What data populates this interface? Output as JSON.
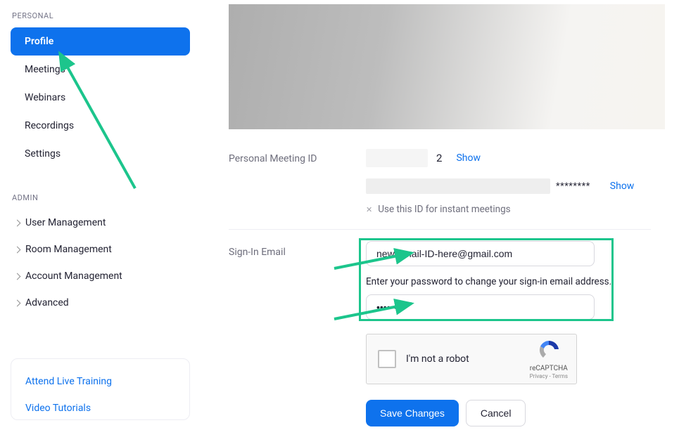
{
  "sidebar": {
    "personal_label": "PERSONAL",
    "items": [
      {
        "label": "Profile"
      },
      {
        "label": "Meetings"
      },
      {
        "label": "Webinars"
      },
      {
        "label": "Recordings"
      },
      {
        "label": "Settings"
      }
    ],
    "admin_label": "ADMIN",
    "admin_items": [
      {
        "label": "User Management"
      },
      {
        "label": "Room Management"
      },
      {
        "label": "Account Management"
      },
      {
        "label": "Advanced"
      }
    ],
    "resources": [
      {
        "label": "Attend Live Training"
      },
      {
        "label": "Video Tutorials"
      }
    ]
  },
  "main": {
    "pmi": {
      "label": "Personal Meeting ID",
      "digit_suffix": "2",
      "show": "Show",
      "url_stars": "********",
      "show2": "Show",
      "use_id_text": "Use this ID for instant meetings"
    },
    "signin": {
      "label": "Sign-In Email",
      "email_value": "new-email-ID-here@gmail.com",
      "helper": "Enter your password to change your sign-in email address.",
      "password_value": "••••••••"
    },
    "captcha": {
      "text": "I'm not a robot",
      "brand": "reCAPTCHA",
      "terms": "Privacy - Terms"
    },
    "buttons": {
      "save": "Save Changes",
      "cancel": "Cancel"
    }
  }
}
